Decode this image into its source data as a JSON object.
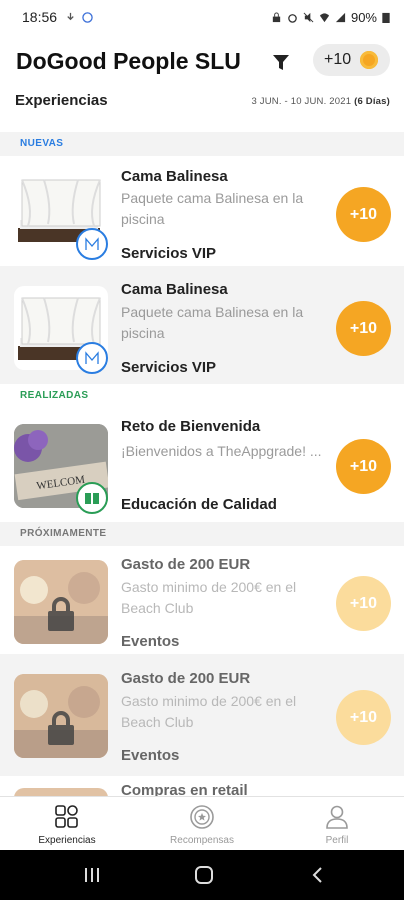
{
  "status": {
    "time": "18:56",
    "battery": "90%"
  },
  "header": {
    "title": "DoGood People SLU",
    "points_label": "+10",
    "subtitle": "Experiencias",
    "date_range": "3 JUN. - 10 JUN. 2021",
    "date_days": "(6 Días)"
  },
  "sections": {
    "new": "NUEVAS",
    "done": "REALIZADAS",
    "soon": "PRÓXIMAMENTE"
  },
  "cards": [
    {
      "title": "Cama Balinesa",
      "desc": "Paquete cama Balinesa en la piscina",
      "category": "Servicios VIP",
      "points": "+10"
    },
    {
      "title": "Cama Balinesa",
      "desc": "Paquete cama Balinesa en la piscina",
      "category": "Servicios VIP",
      "points": "+10"
    },
    {
      "title": "Reto de Bienvenida",
      "desc": "¡Bienvenidos a TheAppgrade! ...",
      "category": "Educación de Calidad",
      "points": "+10"
    },
    {
      "title": "Gasto de 200 EUR",
      "desc": "Gasto minimo de 200€ en el Beach Club",
      "category": "Eventos",
      "points": "+10"
    },
    {
      "title": "Gasto de 200 EUR",
      "desc": "Gasto minimo de 200€ en el Beach Club",
      "category": "Eventos",
      "points": "+10"
    },
    {
      "title": "Compras en retail"
    }
  ],
  "tabs": {
    "experiences": "Experiencias",
    "rewards": "Recompensas",
    "profile": "Perfil"
  },
  "colors": {
    "accent_orange": "#f5a623",
    "blue": "#2a7de1",
    "green": "#2a9d56"
  },
  "icons": [
    "filter-icon",
    "coin-icon",
    "lock-icon",
    "grid-icon",
    "medal-icon",
    "person-icon"
  ]
}
